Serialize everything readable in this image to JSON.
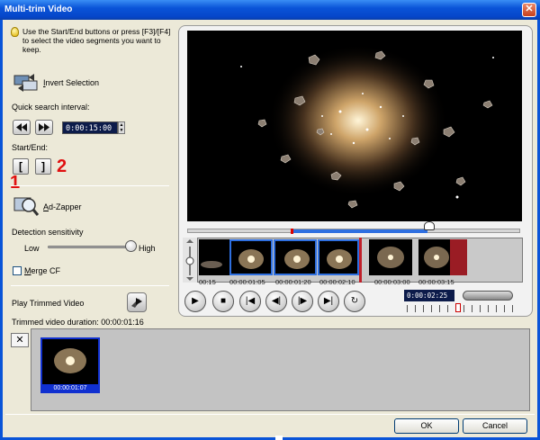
{
  "window": {
    "title": "Multi-trim Video"
  },
  "hint": "Use the Start/End buttons or press [F3]/[F4] to select the video segments you want to keep.",
  "invert_selection": {
    "prefix": "",
    "underlined": "I",
    "rest": "nvert Selection"
  },
  "quick_search": {
    "label": "Quick search interval:",
    "time": "0:00:15:00"
  },
  "start_end": {
    "label": "Start/End:",
    "start_glyph": "[",
    "end_glyph": "]"
  },
  "annotations": {
    "one": "1",
    "two": "2"
  },
  "ad_zapper": {
    "underlined": "A",
    "rest": "d-Zapper"
  },
  "detection": {
    "label": "Detection sensitivity",
    "low": "Low",
    "high": "High",
    "level": 0.88
  },
  "merge_cf": {
    "underlined": "M",
    "rest": "erge CF",
    "checked": false
  },
  "play_trimmed": {
    "label": "Play Trimmed Video"
  },
  "trimmed_duration": "Trimmed video duration: 00:00:01:16",
  "timeline": {
    "timestamps": [
      "00:15",
      "00:00:01:05",
      "00:00:01:20",
      "00:00:02:10",
      "00:00:03:00",
      "00:00:03:15"
    ],
    "timecode": "0:00:02:25"
  },
  "clips": [
    {
      "label": "00:00:01:07"
    }
  ],
  "buttons": {
    "ok": "OK",
    "cancel": "Cancel"
  },
  "colors": {
    "titlebar": "#0a54d8",
    "selection": "#2e6fe0",
    "annotation": "#e01010"
  }
}
